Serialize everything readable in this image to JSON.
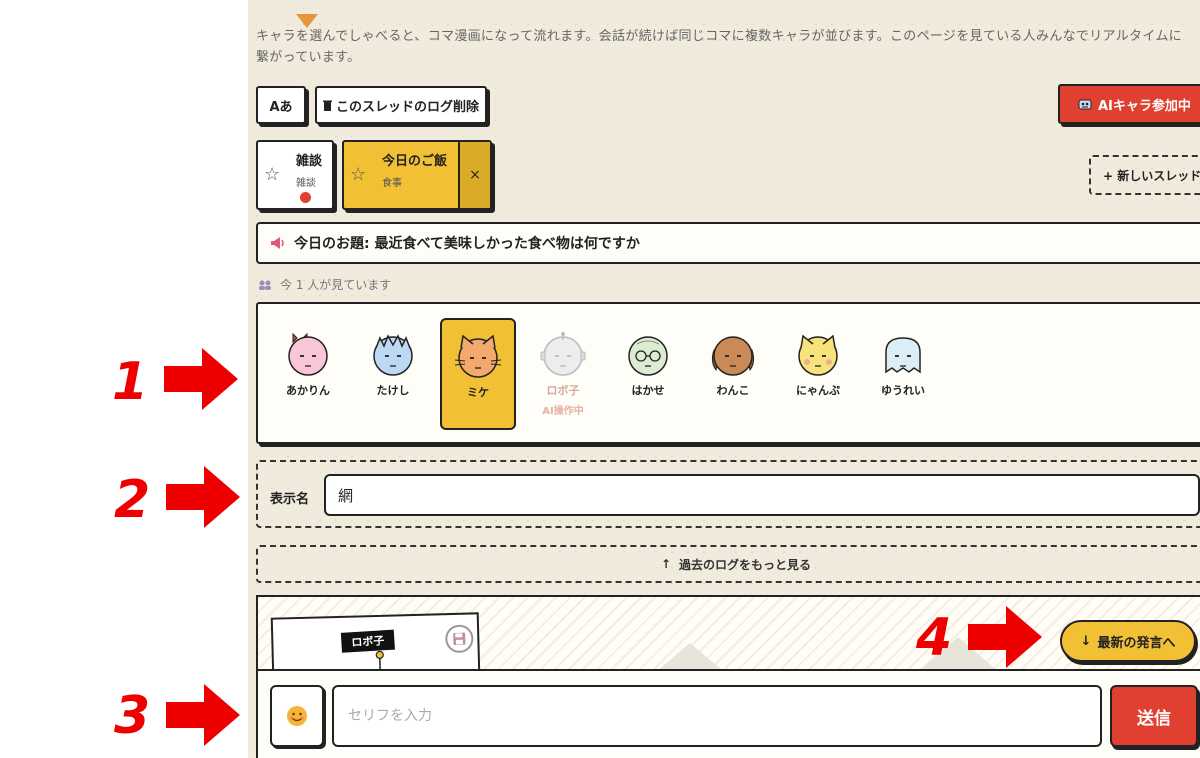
{
  "intro": {
    "line1": "キャラを選んでしゃべると、コマ漫画になって流れます。会話が続けば同じコマに複数キャラが並びます。このページを見ている人みんなでリアルタイムに",
    "line2": "繋がっています。"
  },
  "toolbar": {
    "font_label": "Aあ",
    "delete_log_label": "このスレッドのログ削除",
    "ai_join_label": "AIキャラ参加中"
  },
  "threads": [
    {
      "title": "雑談",
      "category": "雑談",
      "starred": false,
      "active": false,
      "unread": true
    },
    {
      "title": "今日のご飯",
      "category": "食事",
      "starred": false,
      "active": true,
      "unread": false
    }
  ],
  "new_thread_label": "+ 新しいスレッド",
  "close_glyph": "×",
  "topic": {
    "label": "今日のお題: 最近食べて美味しかった食べ物は何ですか"
  },
  "viewers": {
    "text": "今 1 人が見ています"
  },
  "characters": [
    {
      "name": "あかりん",
      "color": "#f9c6d7",
      "selected": false
    },
    {
      "name": "たけし",
      "color": "#bcd8f2",
      "selected": false
    },
    {
      "name": "ミケ",
      "color": "#f3a96b",
      "selected": true
    },
    {
      "name": "ロボ子",
      "color": "#ededed",
      "selected": false,
      "status": "AI操作中"
    },
    {
      "name": "はかせ",
      "color": "#dcecd2",
      "selected": false
    },
    {
      "name": "わんこ",
      "color": "#c98a55",
      "selected": false
    },
    {
      "name": "にゃんぷ",
      "color": "#f6e37c",
      "selected": false
    },
    {
      "name": "ゆうれい",
      "color": "#dbeef6",
      "selected": false
    }
  ],
  "display_name": {
    "label": "表示名",
    "value": "網"
  },
  "more_log_label": "過去のログをもっと見る",
  "comic": {
    "speaker_tag": "ロボ子"
  },
  "latest_label": "最新の発言へ",
  "composer": {
    "placeholder": "セリフを入力",
    "send_label": "送信"
  },
  "annotations": [
    {
      "num": "1"
    },
    {
      "num": "2"
    },
    {
      "num": "3"
    },
    {
      "num": "4"
    }
  ],
  "colors": {
    "accent_yellow": "#f2c034",
    "accent_red": "#e04030",
    "page_bg": "#f0ebdc",
    "annotation_red": "#ee0000"
  }
}
